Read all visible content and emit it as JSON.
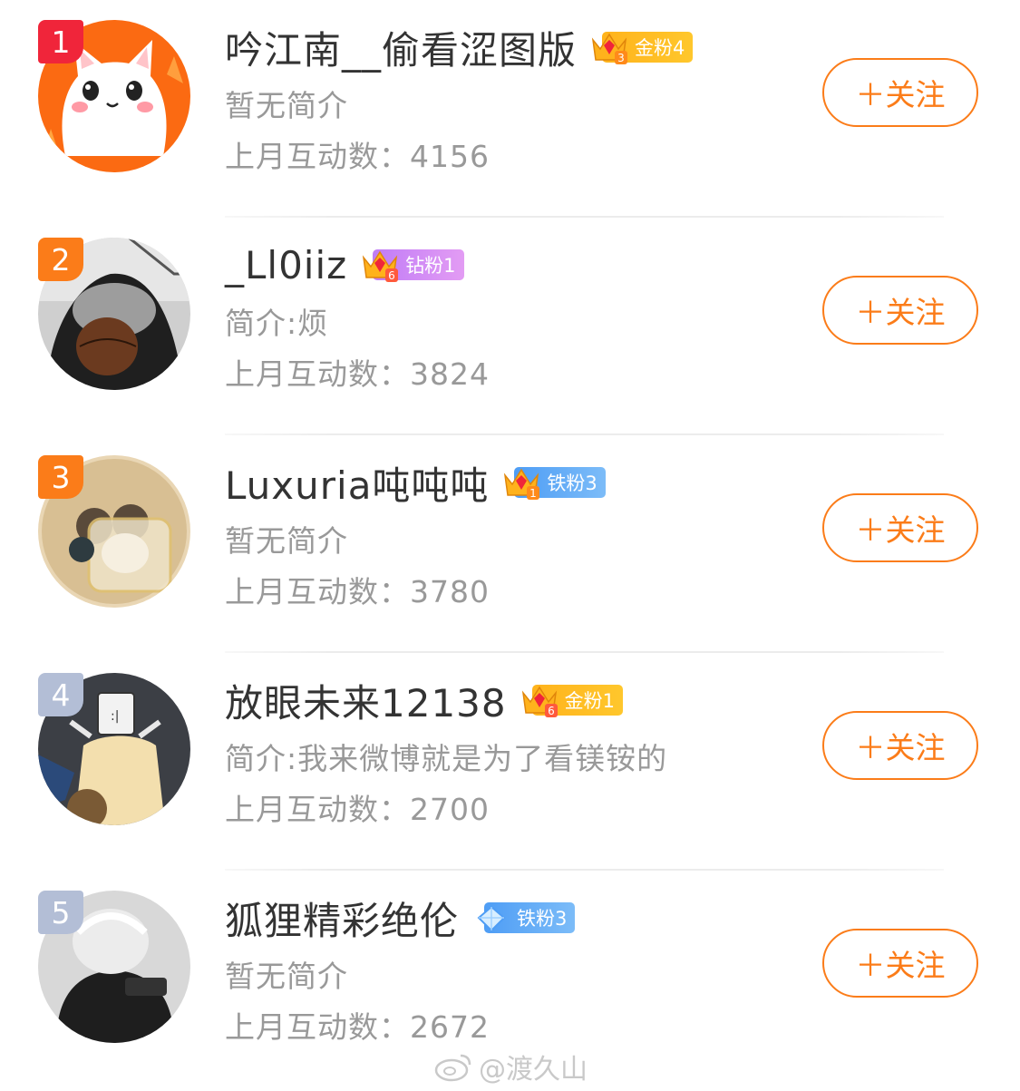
{
  "rows": [
    {
      "rank": "1",
      "name": "吟江南__偷看涩图版",
      "badge": "金粉4",
      "crown_level": "3",
      "intro": "暂无简介",
      "stat_label": "上月互动数：",
      "stat_value": "4156",
      "follow": "＋关注"
    },
    {
      "rank": "2",
      "name": "_Ll0iiz",
      "badge": "钻粉1",
      "crown_level": "6",
      "intro": "简介:烦",
      "stat_label": "上月互动数：",
      "stat_value": "3824",
      "follow": "＋关注"
    },
    {
      "rank": "3",
      "name": "Luxuria吨吨吨",
      "badge": "铁粉3",
      "crown_level": "1",
      "intro": "暂无简介",
      "stat_label": "上月互动数：",
      "stat_value": "3780",
      "follow": "＋关注"
    },
    {
      "rank": "4",
      "name": "放眼未来12138",
      "badge": "金粉1",
      "crown_level": "6",
      "intro": "简介:我来微博就是为了看镁铵的",
      "stat_label": "上月互动数：",
      "stat_value": "2700",
      "follow": "＋关注"
    },
    {
      "rank": "5",
      "name": "狐狸精彩绝伦",
      "badge": "铁粉3",
      "crown_level": "",
      "intro": "暂无简介",
      "stat_label": "上月互动数：",
      "stat_value": "2672",
      "follow": "＋关注"
    }
  ],
  "watermark": "@渡久山",
  "colors": {
    "accent": "#fb7c19",
    "rank_top": "#f0253a",
    "rank_grey": "#b3bed6",
    "gold": "#ffb31c",
    "diamond": "#c07cf6",
    "iron": "#4e9df5"
  },
  "icons": {
    "crown": "crown-icon",
    "diamond": "diamond-icon",
    "weibo": "weibo-logo-icon"
  }
}
